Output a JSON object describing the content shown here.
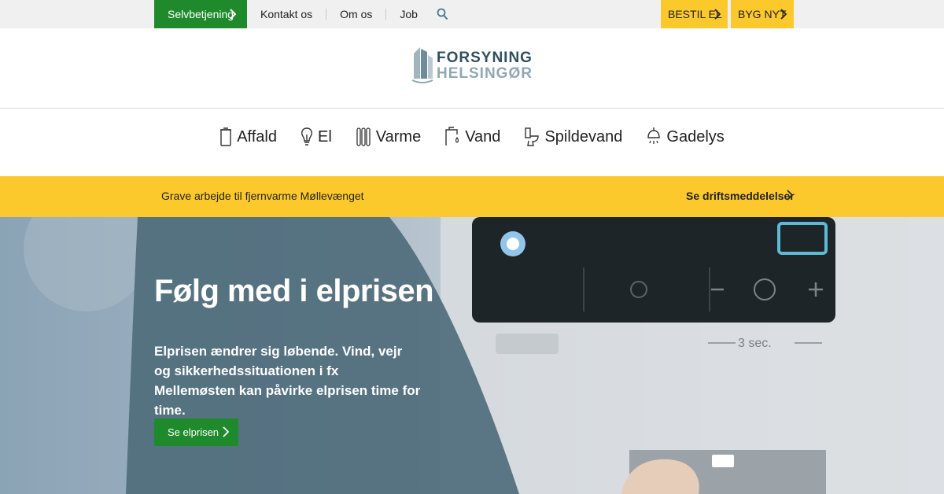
{
  "topbar": {
    "self_service": "Selvbetjening",
    "links": [
      "Kontakt os",
      "Om os",
      "Job"
    ],
    "search_icon": "search-icon",
    "order_power": "BESTIL EL",
    "build_new": "BYG NYT"
  },
  "logo": {
    "line1": "FORSYNING",
    "line2": "HELSINGØR"
  },
  "nav": {
    "items": [
      {
        "label": "Affald",
        "icon": "waste-bin-icon"
      },
      {
        "label": "El",
        "icon": "lightbulb-icon"
      },
      {
        "label": "Varme",
        "icon": "radiator-icon"
      },
      {
        "label": "Vand",
        "icon": "faucet-icon"
      },
      {
        "label": "Spildevand",
        "icon": "toilet-icon"
      },
      {
        "label": "Gadelys",
        "icon": "streetlamp-icon"
      }
    ]
  },
  "notice": {
    "message": "Grave arbejde til fjernvarme Møllevænget",
    "link": "Se driftsmeddelelser"
  },
  "hero": {
    "title": "Følg med i elprisen",
    "lead": "Elprisen ændrer sig løbende. Vind, vejr og sikkerhedssituationen i fx Mellemøsten kan påvirke elprisen time for time.",
    "cta": "Se elprisen",
    "display_text": "3 sec."
  },
  "colors": {
    "green": "#1f8a2c",
    "yellow": "#fcc92c",
    "panel": "#4f6d7c",
    "logo_dark": "#2e4f60",
    "logo_light": "#8fa8b4"
  }
}
